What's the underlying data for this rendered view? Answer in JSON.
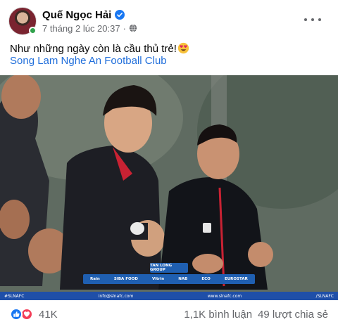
{
  "post": {
    "author": "Quế Ngọc Hải",
    "timestamp": "7 tháng 2 lúc 20:37",
    "separator": "·",
    "caption": "Như những ngày còn là cầu thủ trẻ!",
    "page_link": "Song Lam Nghe An Football Club"
  },
  "photo": {
    "sponsor_top": "TAN LONG GROUP",
    "sponsors": [
      "Rain",
      "SIBA FOOD",
      "Vitrin",
      "NAB",
      "ECO",
      "EUROSTAR"
    ],
    "footer": {
      "hashtag": "#SLNAFC",
      "email": "info@slnafc.com",
      "website": "www.slnafc.com",
      "social": "/SLNAFC"
    }
  },
  "engagement": {
    "reaction_count": "41K",
    "comments": "1,1K bình luận",
    "shares": "49 lượt chia sẻ"
  },
  "colors": {
    "link": "#216fdb",
    "like": "#1877f2",
    "love": "#f33e58",
    "verified": "#1877f2",
    "online": "#31a24c"
  },
  "icons": [
    "verified-icon",
    "globe-icon",
    "more-icon",
    "heart-eyes-emoji",
    "like-reaction-icon",
    "love-reaction-icon"
  ]
}
